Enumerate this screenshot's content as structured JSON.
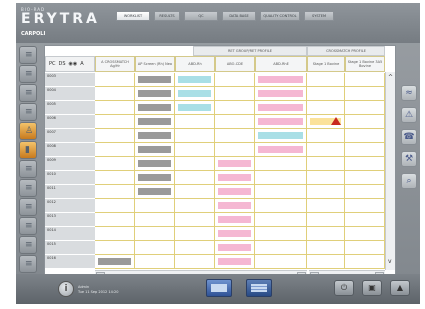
{
  "header": {
    "brand_small": "BIO-RAD",
    "brand": "ERYTRA",
    "station": "CARPOLI",
    "tabs": [
      {
        "label": "WORKLIST",
        "active": true
      },
      {
        "label": "RESULTS",
        "active": false
      },
      {
        "label": "QC",
        "active": false
      },
      {
        "label": "DATA BASE",
        "active": false
      },
      {
        "label": "QUALITY CONTROL",
        "active": false
      },
      {
        "label": "SYSTEM",
        "active": false
      }
    ]
  },
  "grid": {
    "group_headers": [
      "RET GROUP/RET PROFILE",
      "CROSSMATCH PROFILE"
    ],
    "toolbar": {
      "item1": "PC",
      "item2": "DS",
      "item3": "A"
    },
    "column_headers": [
      "A CROSSMATCH Ag/Hr",
      "AP Screen (Rh) Neo",
      "ABD-Rh",
      "ABO-CDE",
      "ABD-RhE",
      "Stage 1 Bovine",
      "Stage 1 Bovine 3A5 Bovine"
    ],
    "rows": [
      {
        "label": "0003",
        "chips": [
          "",
          "gray",
          "cyan",
          "",
          "pink",
          "",
          ""
        ]
      },
      {
        "label": "0004",
        "chips": [
          "",
          "gray",
          "cyan",
          "",
          "pink",
          "",
          ""
        ]
      },
      {
        "label": "0005",
        "chips": [
          "",
          "gray",
          "cyan",
          "",
          "pink",
          "",
          ""
        ]
      },
      {
        "label": "0006",
        "chips": [
          "",
          "gray",
          "",
          "",
          "pink",
          "yellow",
          ""
        ]
      },
      {
        "label": "0007",
        "chips": [
          "",
          "gray",
          "",
          "",
          "cyan",
          "",
          ""
        ]
      },
      {
        "label": "0008",
        "chips": [
          "",
          "gray",
          "",
          "",
          "pink",
          "",
          ""
        ]
      },
      {
        "label": "0009",
        "chips": [
          "",
          "gray",
          "",
          "pink",
          "",
          "",
          ""
        ]
      },
      {
        "label": "0010",
        "chips": [
          "",
          "gray",
          "",
          "pink",
          "",
          "",
          ""
        ]
      },
      {
        "label": "0011",
        "chips": [
          "",
          "gray",
          "",
          "pink",
          "",
          "",
          ""
        ]
      },
      {
        "label": "0012",
        "chips": [
          "",
          "",
          "",
          "pink",
          "",
          "",
          ""
        ]
      },
      {
        "label": "0013",
        "chips": [
          "",
          "",
          "",
          "pink",
          "",
          "",
          ""
        ]
      },
      {
        "label": "0014",
        "chips": [
          "",
          "",
          "",
          "pink",
          "",
          "",
          ""
        ]
      },
      {
        "label": "0015",
        "chips": [
          "",
          "",
          "",
          "pink",
          "",
          "",
          ""
        ]
      },
      {
        "label": "0016",
        "chips": [
          "gray",
          "",
          "",
          "pink",
          "",
          "",
          ""
        ]
      }
    ],
    "alert_row": 3,
    "scroll": {
      "left": "<",
      "right": ">",
      "mid": "< >",
      "up": "^",
      "down": "v"
    }
  },
  "status": {
    "line1": "Admin",
    "line2": "Tue 11 Sep 2012 14:20"
  },
  "colors": {
    "gray": "#9a9a9a",
    "cyan": "#a9dfe6",
    "pink": "#f5b7d3",
    "yellow": "#fbe29b",
    "alert": "#c8281e"
  },
  "icons": {
    "sidebar": [
      "rack-icon",
      "rack-icon",
      "rack-icon",
      "rack-icon",
      "reagent-icon",
      "tube-icon",
      "rack-icon",
      "rack-icon",
      "rack-icon",
      "rack-icon",
      "rack-icon",
      "rack-icon"
    ],
    "tools": [
      "chart-icon",
      "warning-icon",
      "phone-icon",
      "tools-icon",
      "search-icon"
    ],
    "system": [
      "power-icon",
      "save-icon",
      "lock-icon"
    ]
  }
}
